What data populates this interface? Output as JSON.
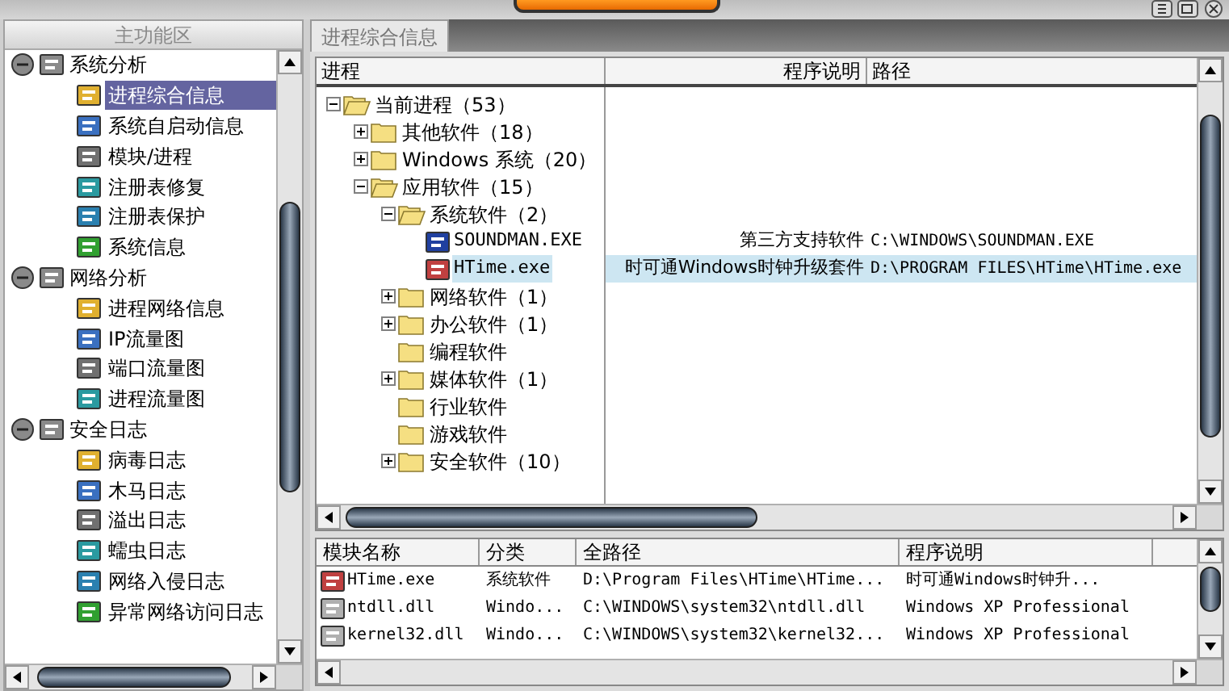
{
  "sidebar": {
    "title": "主功能区",
    "groups": [
      {
        "label": "系统分析",
        "expanded": true,
        "items": [
          {
            "label": "进程综合信息",
            "selected": true
          },
          {
            "label": "系统自启动信息",
            "selected": false
          },
          {
            "label": "模块/进程",
            "selected": false
          },
          {
            "label": "注册表修复",
            "selected": false
          },
          {
            "label": "注册表保护",
            "selected": false
          },
          {
            "label": "系统信息",
            "selected": false
          }
        ]
      },
      {
        "label": "网络分析",
        "expanded": true,
        "items": [
          {
            "label": "进程网络信息",
            "selected": false
          },
          {
            "label": "IP流量图",
            "selected": false
          },
          {
            "label": "端口流量图",
            "selected": false
          },
          {
            "label": "进程流量图",
            "selected": false
          }
        ]
      },
      {
        "label": "安全日志",
        "expanded": true,
        "items": [
          {
            "label": "病毒日志",
            "selected": false
          },
          {
            "label": "木马日志",
            "selected": false
          },
          {
            "label": "溢出日志",
            "selected": false
          },
          {
            "label": "蠕虫日志",
            "selected": false
          },
          {
            "label": "网络入侵日志",
            "selected": false
          },
          {
            "label": "异常网络访问日志",
            "selected": false
          }
        ]
      }
    ]
  },
  "tabs": [
    {
      "label": "进程综合信息",
      "selected": true
    }
  ],
  "process_table": {
    "columns": [
      "进程",
      "程序说明",
      "路径"
    ],
    "tree": [
      {
        "kind": "folder",
        "label": "当前进程（53）",
        "expanded": true,
        "children": [
          {
            "kind": "folder",
            "label": "其他软件（18）",
            "expanded": false
          },
          {
            "kind": "folder",
            "label": "Windows 系统（20）",
            "expanded": false
          },
          {
            "kind": "folder",
            "label": "应用软件（15）",
            "expanded": true,
            "children": [
              {
                "kind": "folder",
                "label": "系统软件（2）",
                "expanded": true,
                "children": [
                  {
                    "kind": "file",
                    "label": "SOUNDMAN.EXE",
                    "description": "第三方支持软件",
                    "path": "C:\\WINDOWS\\SOUNDMAN.EXE",
                    "selected": false
                  },
                  {
                    "kind": "file",
                    "label": "HTime.exe",
                    "description": "时可通Windows时钟升级套件",
                    "path": "D:\\PROGRAM FILES\\HTime\\HTime.exe",
                    "selected": true
                  }
                ]
              },
              {
                "kind": "folder",
                "label": "网络软件（1）",
                "expanded": false
              },
              {
                "kind": "folder",
                "label": "办公软件（1）",
                "expanded": false
              },
              {
                "kind": "folder",
                "label": "编程软件"
              },
              {
                "kind": "folder",
                "label": "媒体软件（1）",
                "expanded": false
              },
              {
                "kind": "folder",
                "label": "行业软件"
              },
              {
                "kind": "folder",
                "label": "游戏软件"
              },
              {
                "kind": "folder",
                "label": "安全软件（10）",
                "expanded": false
              }
            ]
          }
        ]
      }
    ]
  },
  "module_table": {
    "columns": [
      "模块名称",
      "分类",
      "全路径",
      "程序说明"
    ],
    "rows": [
      {
        "kind": "exe",
        "name": "HTime.exe",
        "category": "系统软件",
        "path": "D:\\Program Files\\HTime\\HTime...",
        "description": "时可通Windows时钟升..."
      },
      {
        "kind": "dll",
        "name": "ntdll.dll",
        "category": "Windo...",
        "path": "C:\\WINDOWS\\system32\\ntdll.dll",
        "description": "Windows XP Professional"
      },
      {
        "kind": "dll",
        "name": "kernel32.dll",
        "category": "Windo...",
        "path": "C:\\WINDOWS\\system32\\kernel32...",
        "description": "Windows XP Professional"
      }
    ]
  }
}
